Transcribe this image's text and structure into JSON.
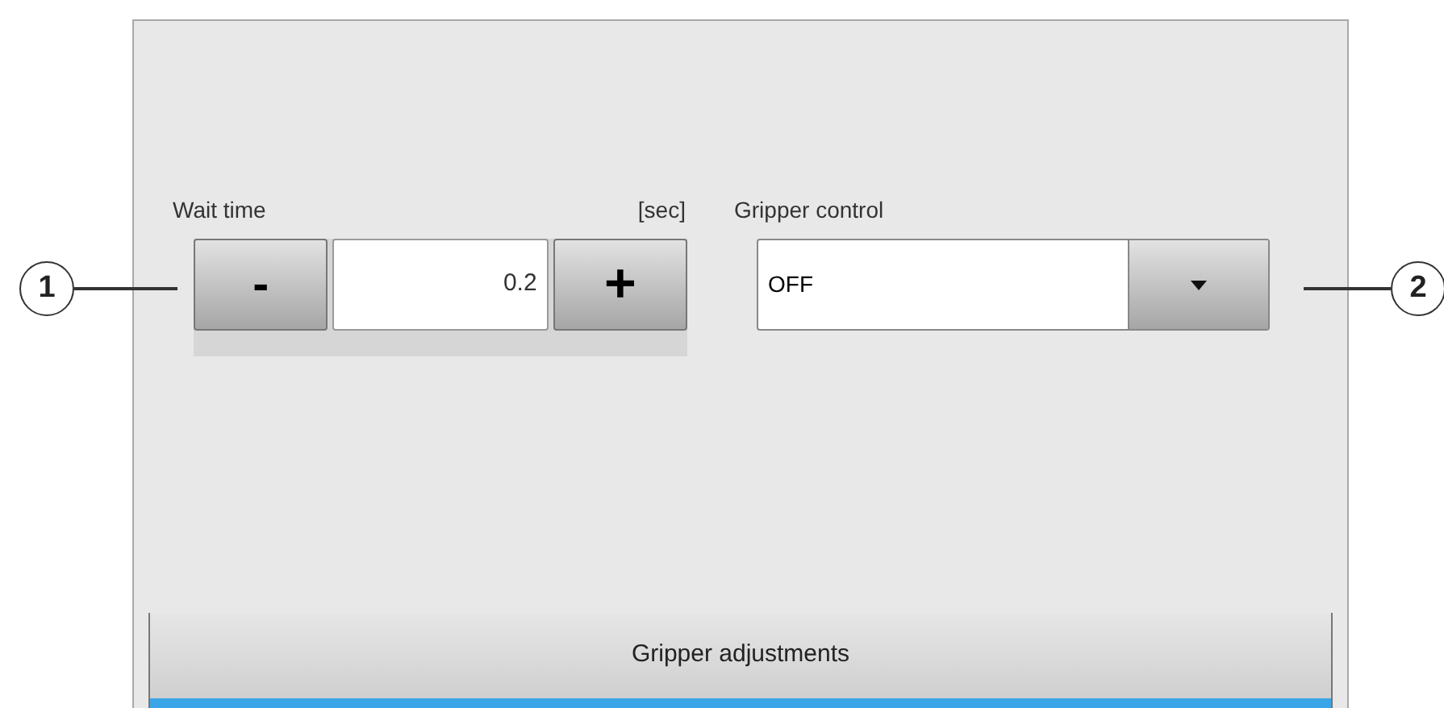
{
  "callouts": [
    {
      "number": "1"
    },
    {
      "number": "2"
    }
  ],
  "wait_time": {
    "label": "Wait time",
    "unit": "[sec]",
    "decrease": "-",
    "value": "0.2",
    "increase": "+"
  },
  "gripper_control": {
    "label": "Gripper control",
    "value": "OFF"
  },
  "tabs": [
    {
      "label": "Gripper adjustments",
      "selected": true
    }
  ]
}
